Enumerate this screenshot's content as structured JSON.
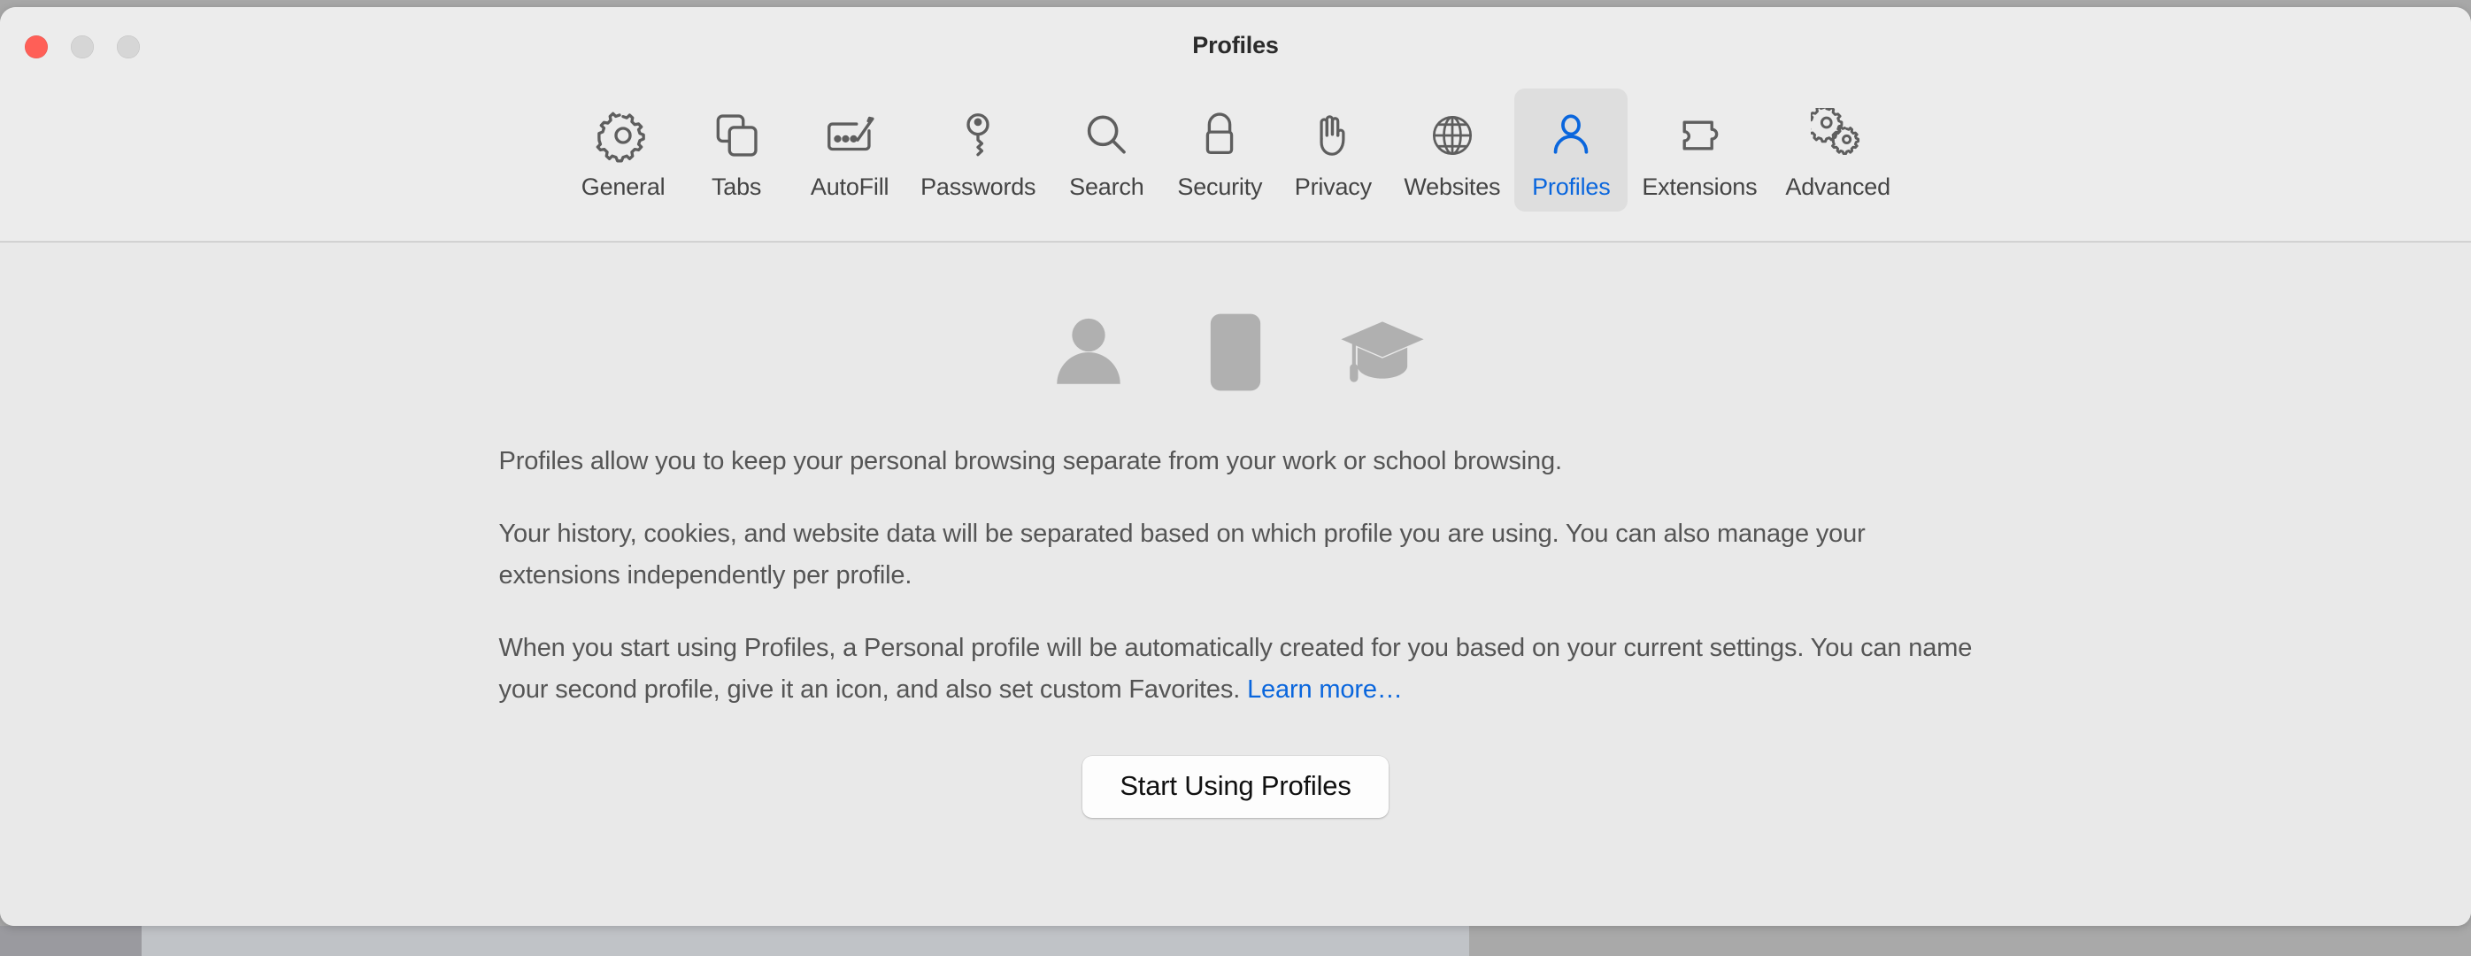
{
  "window": {
    "title": "Profiles",
    "traffic_lights": [
      {
        "name": "close",
        "color": "#ff5f57"
      },
      {
        "name": "minimize",
        "color": "#d6d6d6"
      },
      {
        "name": "maximize",
        "color": "#d6d6d6"
      }
    ]
  },
  "toolbar": {
    "selected": "Profiles",
    "accent_color": "#0a66dd",
    "items": [
      {
        "label": "General",
        "icon": "gear-icon"
      },
      {
        "label": "Tabs",
        "icon": "tabs-icon"
      },
      {
        "label": "AutoFill",
        "icon": "autofill-pencil-form-icon"
      },
      {
        "label": "Passwords",
        "icon": "key-icon"
      },
      {
        "label": "Search",
        "icon": "magnifier-icon"
      },
      {
        "label": "Security",
        "icon": "padlock-icon"
      },
      {
        "label": "Privacy",
        "icon": "hand-icon"
      },
      {
        "label": "Websites",
        "icon": "globe-icon"
      },
      {
        "label": "Profiles",
        "icon": "person-icon"
      },
      {
        "label": "Extensions",
        "icon": "puzzle-piece-icon"
      },
      {
        "label": "Advanced",
        "icon": "double-gears-icon"
      }
    ]
  },
  "content": {
    "illustration_icons": [
      "person-silhouette-icon",
      "id-badge-icon",
      "graduation-cap-icon"
    ],
    "paragraphs": {
      "p1": "Profiles allow you to keep your personal browsing separate from your work or school browsing.",
      "p2": "Your history, cookies, and website data will be separated based on which profile you are using. You can also manage your extensions independently per profile.",
      "p3_before_link": "When you start using Profiles, a Personal profile will be automatically created for you based on your current settings. You can name your second profile, give it an icon, and also set custom Favorites. ",
      "link_label": "Learn more…"
    },
    "primary_button": "Start Using Profiles"
  }
}
